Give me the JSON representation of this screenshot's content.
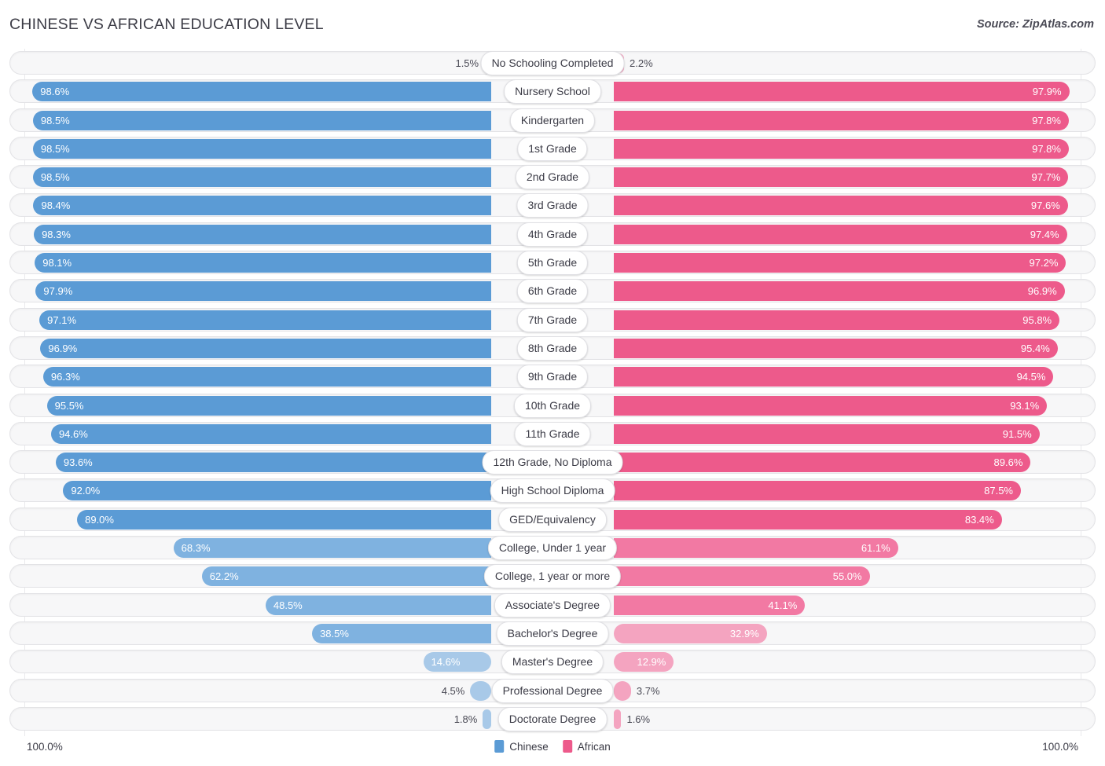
{
  "header": {
    "title": "CHINESE VS AFRICAN EDUCATION LEVEL",
    "source": "Source: ZipAtlas.com"
  },
  "legend": {
    "items": [
      {
        "label": "Chinese",
        "color": "#5B9BD5"
      },
      {
        "label": "African",
        "color": "#ED5A8B"
      }
    ]
  },
  "axis": {
    "left_max": "100.0%",
    "right_max": "100.0%"
  },
  "colors": {
    "chinese_strong": "#5B9BD5",
    "chinese_mid": "#7FB2E0",
    "chinese_light": "#A8C9E8",
    "african_strong": "#ED5A8B",
    "african_mid": "#F279A3",
    "african_light": "#F4A4C0",
    "track": "#F7F7F8",
    "pill": "#FFFFFF"
  },
  "chart_data": {
    "type": "bar",
    "orientation": "horizontal-diverging",
    "title": "CHINESE VS AFRICAN EDUCATION LEVEL",
    "xlabel": "",
    "ylabel": "",
    "xlim": [
      0,
      100
    ],
    "grid": false,
    "legend_position": "bottom-center",
    "categories": [
      "No Schooling Completed",
      "Nursery School",
      "Kindergarten",
      "1st Grade",
      "2nd Grade",
      "3rd Grade",
      "4th Grade",
      "5th Grade",
      "6th Grade",
      "7th Grade",
      "8th Grade",
      "9th Grade",
      "10th Grade",
      "11th Grade",
      "12th Grade, No Diploma",
      "High School Diploma",
      "GED/Equivalency",
      "College, Under 1 year",
      "College, 1 year or more",
      "Associate's Degree",
      "Bachelor's Degree",
      "Master's Degree",
      "Professional Degree",
      "Doctorate Degree"
    ],
    "series": [
      {
        "name": "Chinese",
        "color": "#5B9BD5",
        "values": [
          1.5,
          98.6,
          98.5,
          98.5,
          98.5,
          98.4,
          98.3,
          98.1,
          97.9,
          97.1,
          96.9,
          96.3,
          95.5,
          94.6,
          93.6,
          92.0,
          89.0,
          68.3,
          62.2,
          48.5,
          38.5,
          14.6,
          4.5,
          1.8
        ],
        "labels": [
          "1.5%",
          "98.6%",
          "98.5%",
          "98.5%",
          "98.5%",
          "98.4%",
          "98.3%",
          "98.1%",
          "97.9%",
          "97.1%",
          "96.9%",
          "96.3%",
          "95.5%",
          "94.6%",
          "93.6%",
          "92.0%",
          "89.0%",
          "68.3%",
          "62.2%",
          "48.5%",
          "38.5%",
          "14.6%",
          "4.5%",
          "1.8%"
        ]
      },
      {
        "name": "African",
        "color": "#ED5A8B",
        "values": [
          2.2,
          97.9,
          97.8,
          97.8,
          97.7,
          97.6,
          97.4,
          97.2,
          96.9,
          95.8,
          95.4,
          94.5,
          93.1,
          91.5,
          89.6,
          87.5,
          83.4,
          61.1,
          55.0,
          41.1,
          32.9,
          12.9,
          3.7,
          1.6
        ],
        "labels": [
          "2.2%",
          "97.9%",
          "97.8%",
          "97.8%",
          "97.7%",
          "97.6%",
          "97.4%",
          "97.2%",
          "96.9%",
          "95.8%",
          "95.4%",
          "94.5%",
          "93.1%",
          "91.5%",
          "89.6%",
          "87.5%",
          "83.4%",
          "61.1%",
          "55.0%",
          "41.1%",
          "32.9%",
          "12.9%",
          "3.7%",
          "1.6%"
        ]
      }
    ]
  }
}
